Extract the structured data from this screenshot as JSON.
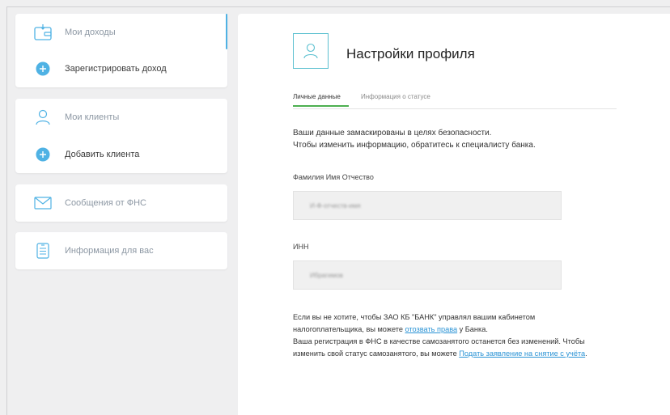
{
  "sidebar": {
    "groups": [
      {
        "items": [
          {
            "label": "Мои доходы",
            "icon": "wallet-icon"
          },
          {
            "label": "Зарегистрировать доход",
            "icon": "plus-circle-icon"
          }
        ]
      },
      {
        "items": [
          {
            "label": "Мои клиенты",
            "icon": "user-icon"
          },
          {
            "label": "Добавить клиента",
            "icon": "plus-circle-icon"
          }
        ]
      },
      {
        "items": [
          {
            "label": "Сообщения от ФНС",
            "icon": "envelope-icon"
          }
        ]
      },
      {
        "items": [
          {
            "label": "Информация для вас",
            "icon": "document-icon"
          }
        ]
      }
    ]
  },
  "profile": {
    "title": "Настройки профиля",
    "tabs": [
      "Личные данные",
      "Информация о статусе"
    ],
    "notice_line1": "Ваши данные замаскированы в целях безопасности.",
    "notice_line2": "Чтобы изменить информацию, обратитесь к специалисту банка.",
    "fio_label": "Фамилия Имя Отчество",
    "fio_value": "И-Ф-отчеств-имя",
    "inn_label": "ИНН",
    "inn_value": "Ибрагимов",
    "footer": {
      "p1": "Если вы не хотите, чтобы ЗАО КБ \"БАНК\" управлял вашим кабинетом налогоплательщика, вы можете ",
      "link1": "отозвать права",
      "p2": " у Банка.",
      "p3": "Ваша регистрация в ФНС в качестве самозанятого останется без изменений. Чтобы изменить свой статус самозанятого, вы можете ",
      "link2": "Подать заявление на снятие с учёта",
      "p4": "."
    }
  },
  "colors": {
    "accent_blue": "#4fb2e4",
    "tab_green": "#4caf50",
    "link": "#2a93d5",
    "avatar_border": "#5bc0d0"
  }
}
